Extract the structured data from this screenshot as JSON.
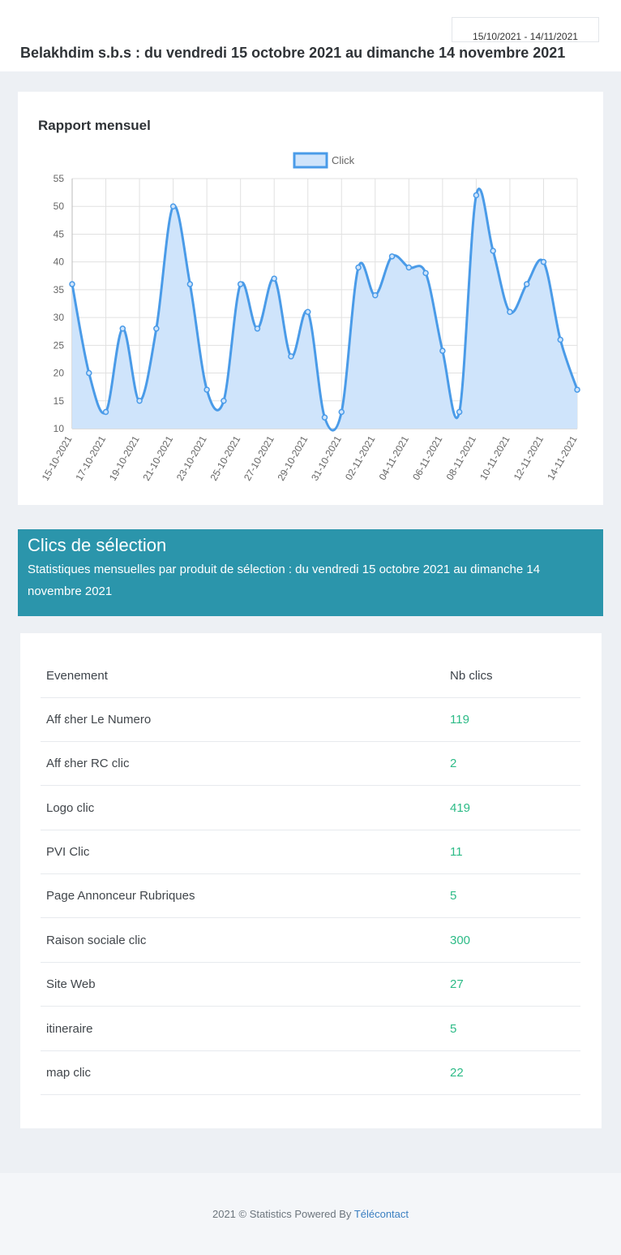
{
  "header": {
    "date_range": "15/10/2021 - 14/11/2021",
    "title": "Belakhdim s.b.s : du vendredi 15 octobre 2021 au dimanche 14 novembre 2021"
  },
  "chart_card": {
    "title": "Rapport mensuel"
  },
  "chart_data": {
    "type": "area",
    "legend": "top-center",
    "grid": true,
    "ylim": [
      10,
      55
    ],
    "yticks": [
      10,
      15,
      20,
      25,
      30,
      35,
      40,
      45,
      50,
      55
    ],
    "tick_labels": [
      "15-10-2021",
      "17-10-2021",
      "19-10-2021",
      "21-10-2021",
      "23-10-2021",
      "25-10-2021",
      "27-10-2021",
      "29-10-2021",
      "31-10-2021",
      "02-11-2021",
      "04-11-2021",
      "06-11-2021",
      "08-11-2021",
      "10-11-2021",
      "12-11-2021",
      "14-11-2021"
    ],
    "series": [
      {
        "name": "Click",
        "color": "#4a9be8",
        "fill": "#cfe4fb",
        "values": [
          36,
          20,
          13,
          28,
          15,
          28,
          50,
          36,
          17,
          15,
          36,
          28,
          37,
          23,
          31,
          12,
          13,
          39,
          34,
          41,
          39,
          38,
          24,
          13,
          52,
          42,
          31,
          36,
          40,
          26,
          17
        ]
      }
    ]
  },
  "selection": {
    "title": "Clics de sélection",
    "subtitle": "Statistiques mensuelles par produit de sélection : du vendredi 15 octobre 2021 au dimanche 14 novembre 2021",
    "accent": "#2b95ab"
  },
  "table": {
    "columns": [
      "Evenement",
      "Nb clics"
    ],
    "rows": [
      {
        "name": "Aff ɛher Le Numero",
        "value": "119"
      },
      {
        "name": "Aff ɛher RC clic",
        "value": "2"
      },
      {
        "name": "Logo clic",
        "value": "419"
      },
      {
        "name": "PVI Clic",
        "value": "11"
      },
      {
        "name": "Page Annonceur Rubriques",
        "value": "5"
      },
      {
        "name": "Raison sociale clic",
        "value": "300"
      },
      {
        "name": "Site Web",
        "value": "27"
      },
      {
        "name": "itineraire",
        "value": "5"
      },
      {
        "name": "map clic",
        "value": "22"
      }
    ]
  },
  "footer": {
    "text": "2021 © Statistics Powered By ",
    "link": "Télécontact"
  }
}
